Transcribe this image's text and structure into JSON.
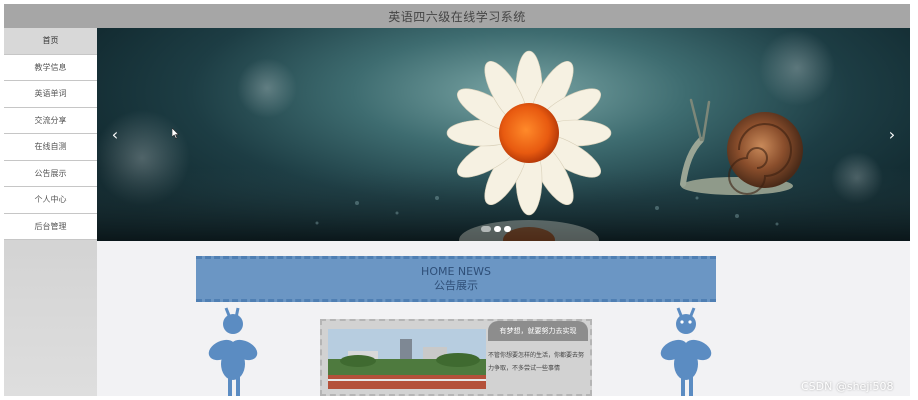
{
  "header": {
    "title": "英语四六级在线学习系统"
  },
  "sidebar": {
    "items": [
      {
        "label": "首页",
        "active": true
      },
      {
        "label": "教学信息",
        "active": false
      },
      {
        "label": "英语单词",
        "active": false
      },
      {
        "label": "交流分享",
        "active": false
      },
      {
        "label": "在线自测",
        "active": false
      },
      {
        "label": "公告展示",
        "active": false
      },
      {
        "label": "个人中心",
        "active": false
      },
      {
        "label": "后台管理",
        "active": false
      }
    ]
  },
  "carousel": {
    "prev_icon": "chevron-left-icon",
    "next_icon": "chevron-right-icon",
    "prev_glyph": "‹",
    "next_glyph": "›",
    "slide_count": 3,
    "active_slide": 2
  },
  "news": {
    "title_en": "HOME NEWS",
    "title_cn": "公告展示",
    "card": {
      "title": "有梦想，就要努力去实现",
      "text": "不管你想要怎样的生活，你都要去努力争取，不多尝试一些事情"
    }
  },
  "colors": {
    "header_bg": "#a6a6a6",
    "news_bg": "#6b96c4",
    "mascot": "#5b8cc2",
    "card_title_bg": "#8d8d8d"
  },
  "watermark": "CSDN @sheji508"
}
